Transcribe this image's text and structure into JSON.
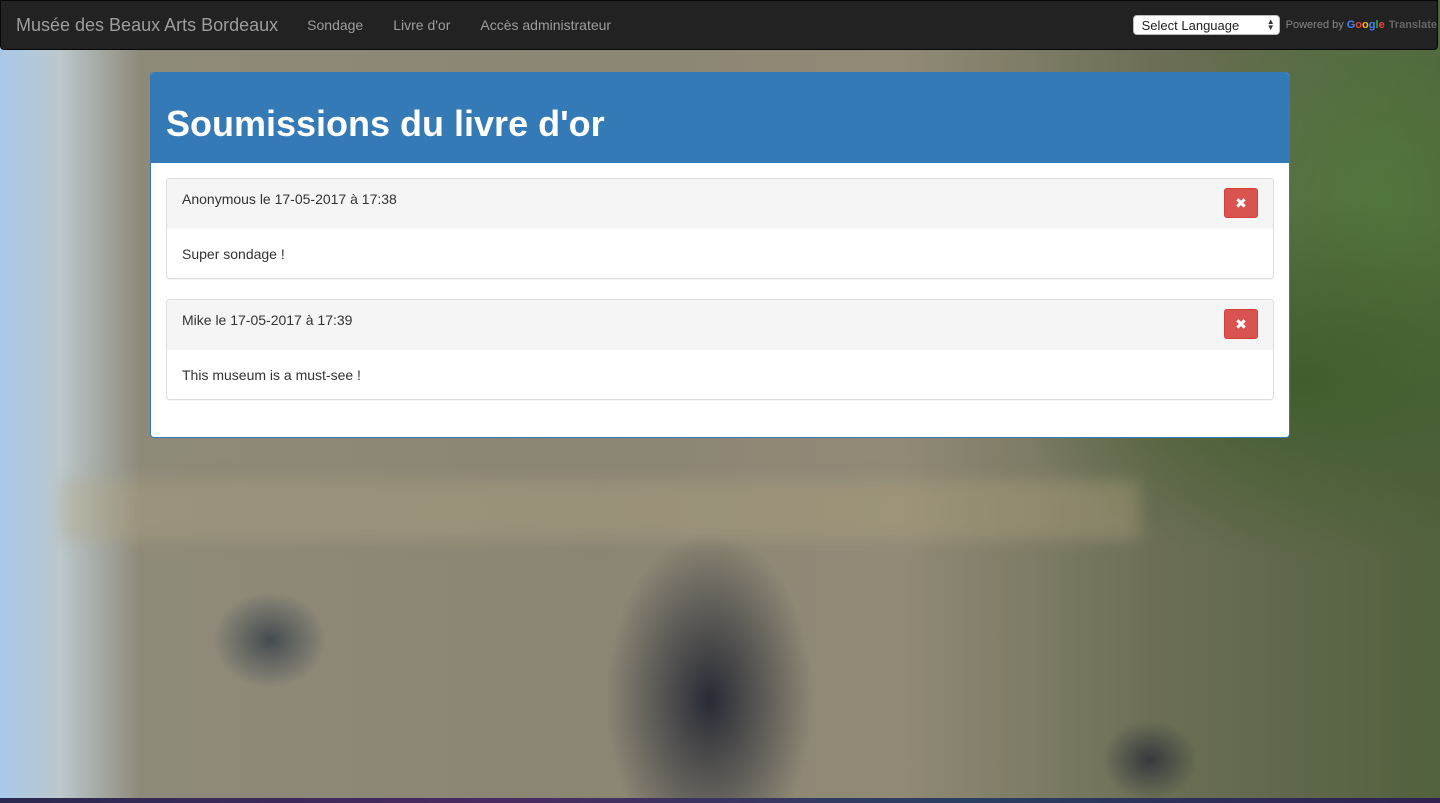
{
  "navbar": {
    "brand": "Musée des Beaux Arts Bordeaux",
    "links": [
      "Sondage",
      "Livre d'or",
      "Accès administrateur"
    ],
    "language_select": "Select Language",
    "powered_by": "Powered by",
    "google": "Google",
    "translate": "Translate"
  },
  "panel": {
    "title": "Soumissions du livre d'or",
    "entries": [
      {
        "header": "Anonymous le 17-05-2017 à 17:38",
        "message": "Super sondage !",
        "delete_icon": "✖"
      },
      {
        "header": "Mike le 17-05-2017 à 17:39",
        "message": "This museum is a must-see !",
        "delete_icon": "✖"
      }
    ]
  },
  "colors": {
    "navbar_bg": "#222222",
    "primary": "#337ab7",
    "danger": "#d9534f"
  }
}
